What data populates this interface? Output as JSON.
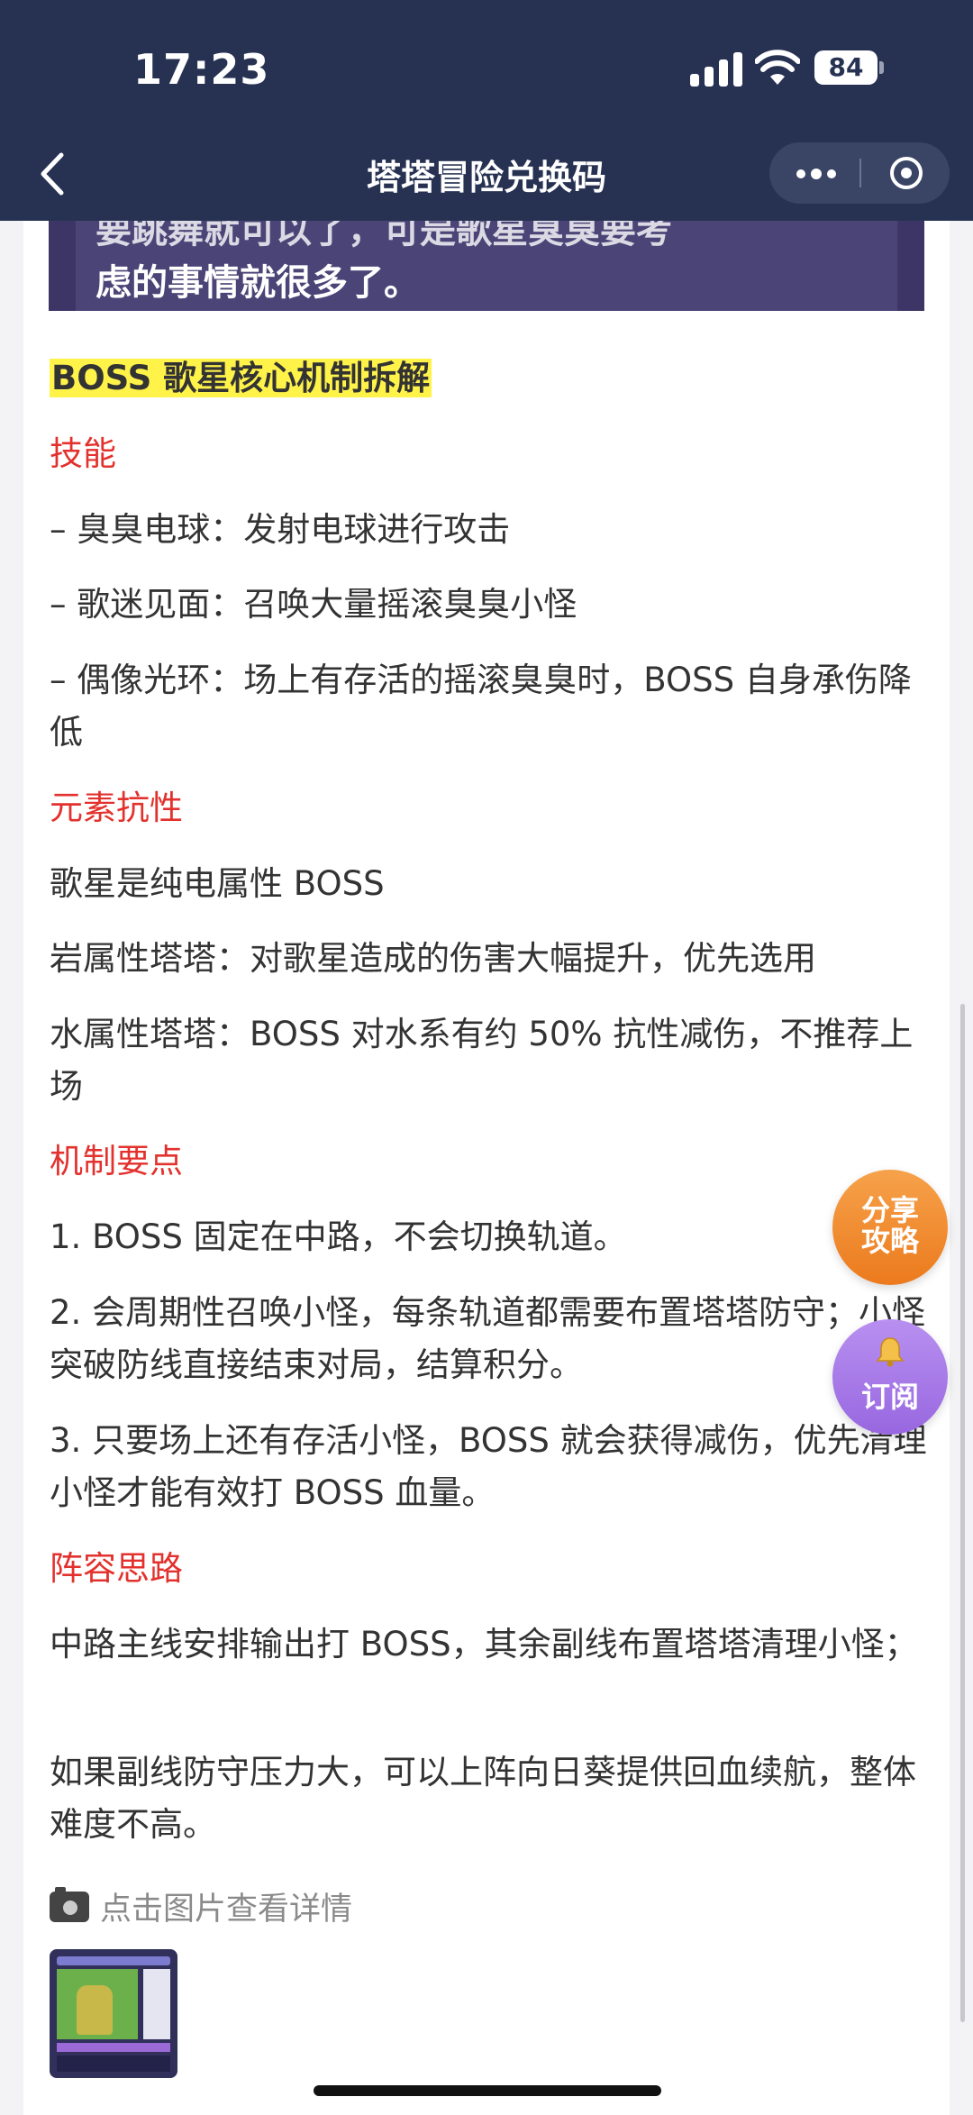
{
  "status": {
    "time": "17:23",
    "battery": "84"
  },
  "nav": {
    "title": "塔塔冒险兑换码"
  },
  "banner": {
    "line1": "要跳舞就可以了，可是歌星臭臭要考",
    "line2": "虑的事情就很多了。"
  },
  "article": {
    "heading": "BOSS 歌星核心机制拆解",
    "skills_title": "技能",
    "skill1": "– 臭臭电球：发射电球进行攻击",
    "skill2": "– 歌迷见面：召唤大量摇滚臭臭小怪",
    "skill3": "– 偶像光环：场上有存活的摇滚臭臭时，BOSS 自身承伤降低",
    "element_title": "元素抗性",
    "element1": "歌星是纯电属性 BOSS",
    "element2": "岩属性塔塔：对歌星造成的伤害大幅提升，优先选用",
    "element3": "水属性塔塔：BOSS 对水系有约 50% 抗性减伤，不推荐上场",
    "mech_title": "机制要点",
    "mech1": "1. BOSS 固定在中路，不会切换轨道。",
    "mech2": "2. 会周期性召唤小怪，每条轨道都需要布置塔塔防守；小怪突破防线直接结束对局，结算积分。",
    "mech3": "3. 只要场上还有存活小怪，BOSS 就会获得减伤，优先清理小怪才能有效打 BOSS 血量。",
    "lineup_title": "阵容思路",
    "lineup1": "中路主线安排输出打 BOSS，其余副线布置塔塔清理小怪；",
    "lineup2": "如果副线防守压力大，可以上阵向日葵提供回血续航，整体难度不高。",
    "image_link": "点击图片查看详情"
  },
  "floating": {
    "share_line1": "分享",
    "share_line2": "攻略",
    "subscribe": "订阅"
  },
  "colors": {
    "nav_bg": "#273253",
    "highlight": "#fff34a",
    "section_red": "#e3312d",
    "share_orange": "#ef8428",
    "subscribe_purple": "#a97be8"
  },
  "icons": [
    "back-icon",
    "more-icon",
    "target-icon",
    "camera-icon",
    "bell-icon",
    "signal-icon",
    "wifi-icon",
    "battery-icon"
  ]
}
